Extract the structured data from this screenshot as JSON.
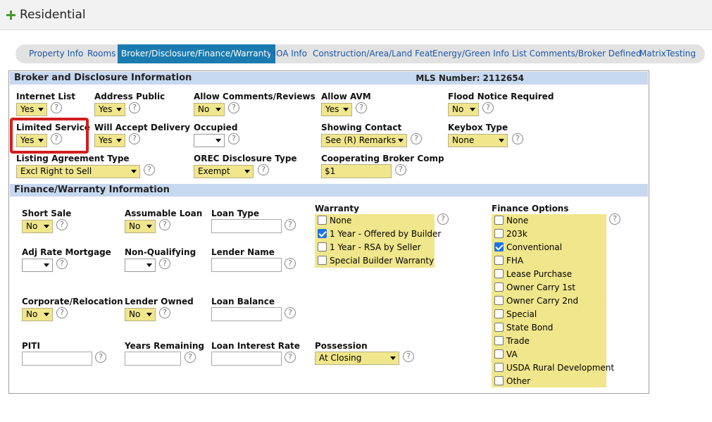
{
  "header": {
    "title": "Residential"
  },
  "tabs": [
    {
      "label": "Property Info",
      "active": false
    },
    {
      "label": "Rooms",
      "active": false
    },
    {
      "label": "Broker/Disclosure/Finance/Warranty",
      "active": true
    },
    {
      "label": "HOA Info",
      "active": false
    },
    {
      "label": "Construction/Area/Land Feat",
      "active": false
    },
    {
      "label": "Energy/Green Info",
      "active": false
    },
    {
      "label": "List Comments/Broker Defined",
      "active": false
    },
    {
      "label": "MatrixTesting",
      "active": false
    }
  ],
  "broker": {
    "heading": "Broker and Disclosure Information",
    "mls_number": "MLS Number: 2112654",
    "internet_list": {
      "label": "Internet List",
      "value": "Yes"
    },
    "address_public": {
      "label": "Address Public",
      "value": "Yes"
    },
    "allow_comments": {
      "label": "Allow Comments/Reviews",
      "value": "No"
    },
    "allow_avm": {
      "label": "Allow AVM",
      "value": "Yes"
    },
    "flood_notice": {
      "label": "Flood Notice Required",
      "value": "No"
    },
    "limited_service": {
      "label": "Limited Service",
      "value": "Yes"
    },
    "will_accept_delivery": {
      "label": "Will Accept Delivery",
      "value": "Yes"
    },
    "occupied": {
      "label": "Occupied",
      "value": ""
    },
    "showing_contact": {
      "label": "Showing Contact",
      "value": "See (R) Remarks"
    },
    "keybox_type": {
      "label": "Keybox Type",
      "value": "None"
    },
    "listing_agreement": {
      "label": "Listing Agreement Type",
      "value": "Excl Right to Sell"
    },
    "orec_disclosure": {
      "label": "OREC Disclosure Type",
      "value": "Exempt"
    },
    "coop_broker_comp": {
      "label": "Cooperating Broker Comp",
      "value": "$1"
    }
  },
  "finance": {
    "heading": "Finance/Warranty Information",
    "short_sale": {
      "label": "Short Sale",
      "value": "No"
    },
    "assumable_loan": {
      "label": "Assumable Loan",
      "value": "No"
    },
    "loan_type": {
      "label": "Loan Type",
      "value": ""
    },
    "adj_rate": {
      "label": "Adj Rate Mortgage",
      "value": ""
    },
    "non_qualifying": {
      "label": "Non-Qualifying",
      "value": ""
    },
    "lender_name": {
      "label": "Lender Name",
      "value": ""
    },
    "corporate_relocation": {
      "label": "Corporate/Relocation",
      "value": "No"
    },
    "lender_owned": {
      "label": "Lender Owned",
      "value": "No"
    },
    "loan_balance": {
      "label": "Loan Balance",
      "value": ""
    },
    "piti": {
      "label": "PITI",
      "value": ""
    },
    "years_remaining": {
      "label": "Years Remaining",
      "value": ""
    },
    "loan_interest_rate": {
      "label": "Loan Interest Rate",
      "value": ""
    },
    "possession": {
      "label": "Possession",
      "value": "At Closing"
    },
    "warranty": {
      "label": "Warranty",
      "options": [
        {
          "label": "None",
          "checked": false
        },
        {
          "label": "1 Year - Offered by Builder",
          "checked": true
        },
        {
          "label": "1 Year - RSA by Seller",
          "checked": false
        },
        {
          "label": "Special Builder Warranty",
          "checked": false
        }
      ]
    },
    "finance_options": {
      "label": "Finance Options",
      "options": [
        {
          "label": "None",
          "checked": false
        },
        {
          "label": "203k",
          "checked": false
        },
        {
          "label": "Conventional",
          "checked": true
        },
        {
          "label": "FHA",
          "checked": false
        },
        {
          "label": "Lease Purchase",
          "checked": false
        },
        {
          "label": "Owner Carry 1st",
          "checked": false
        },
        {
          "label": "Owner Carry 2nd",
          "checked": false
        },
        {
          "label": "Special",
          "checked": false
        },
        {
          "label": "State Bond",
          "checked": false
        },
        {
          "label": "Trade",
          "checked": false
        },
        {
          "label": "VA",
          "checked": false
        },
        {
          "label": "USDA Rural Development",
          "checked": false
        },
        {
          "label": "Other",
          "checked": false
        }
      ]
    }
  },
  "help_glyph": "?",
  "highlight_color": "#d21f1f"
}
